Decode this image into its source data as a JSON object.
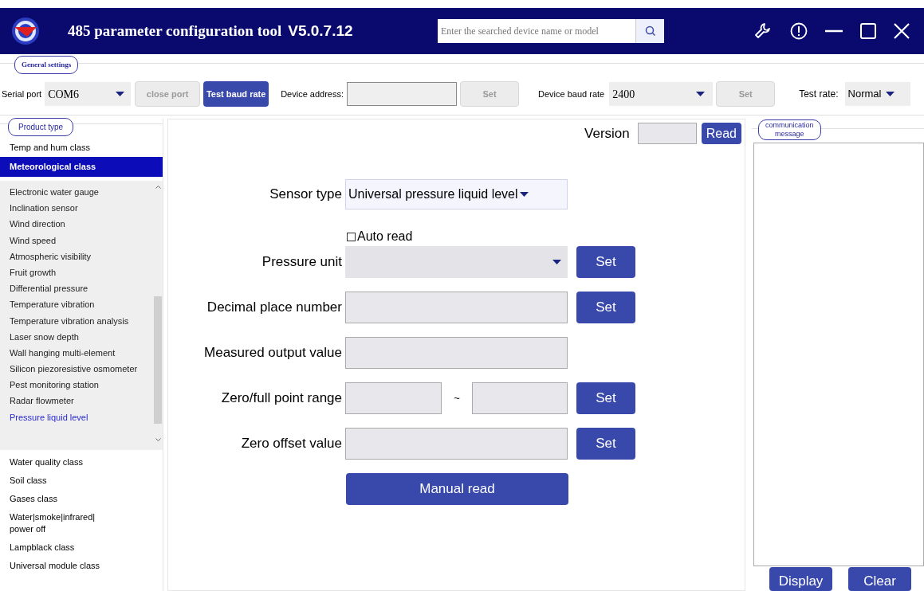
{
  "window": {
    "title": "485 parameter configuration tool",
    "version": "V5.0.7.12",
    "search": {
      "placeholder": "Enter the searched device name or model"
    }
  },
  "general_settings": {
    "legend": "General settings",
    "serial_port": {
      "label": "Serial port",
      "value": "COM6"
    },
    "close_port": {
      "label": "close port",
      "disabled": true
    },
    "test_baud_rate": {
      "label": "Test baud rate"
    },
    "device_address": {
      "label": "Device address:",
      "set": {
        "label": "Set",
        "disabled": true
      }
    },
    "device_baud_rate": {
      "label": "Device baud rate",
      "value": "2400",
      "set": {
        "label": "Set",
        "disabled": true
      }
    },
    "test_rate": {
      "label": "Test rate:",
      "value": "Normal"
    }
  },
  "product_type": {
    "legend": "Product type",
    "categories": [
      {
        "label": "Temp and hum class",
        "selected": false
      },
      {
        "label": "Meteorological class",
        "selected": true,
        "expanded": true,
        "children": [
          {
            "label": "Electronic water gauge",
            "selected": false
          },
          {
            "label": "Inclination sensor",
            "selected": false
          },
          {
            "label": "Wind direction",
            "selected": false
          },
          {
            "label": "Wind speed",
            "selected": false
          },
          {
            "label": "Atmospheric visibility",
            "selected": false
          },
          {
            "label": "Fruit growth",
            "selected": false
          },
          {
            "label": "Differential pressure",
            "selected": false
          },
          {
            "label": "Temperature vibration",
            "selected": false
          },
          {
            "label": "Temperature vibration analysis",
            "selected": false
          },
          {
            "label": "Laser snow depth",
            "selected": false
          },
          {
            "label": "Wall hanging multi-element",
            "selected": false
          },
          {
            "label": "Silicon piezoresistive osmometer",
            "selected": false
          },
          {
            "label": "Pest monitoring station",
            "selected": false
          },
          {
            "label": "Radar flowmeter",
            "selected": false
          },
          {
            "label": "Pressure liquid level",
            "selected": true
          }
        ]
      },
      {
        "label": "Water quality class",
        "selected": false
      },
      {
        "label": "Soil class",
        "selected": false
      },
      {
        "label": "Gases class",
        "selected": false
      },
      {
        "label": "Water|smoke|infrared|\npower off",
        "selected": false
      },
      {
        "label": "Lampblack class",
        "selected": false
      },
      {
        "label": "Universal module class",
        "selected": false
      }
    ]
  },
  "form": {
    "version": {
      "label": "Version",
      "button": "Read"
    },
    "sensor_type": {
      "label": "Sensor type",
      "value": "Universal pressure liquid level"
    },
    "auto_read": {
      "label": "Auto read",
      "checked": false
    },
    "rows": [
      {
        "kind": "select",
        "label": "Pressure unit",
        "button": "Set"
      },
      {
        "kind": "input",
        "label": "Decimal place number",
        "button": "Set"
      },
      {
        "kind": "input",
        "label": "Measured output value"
      },
      {
        "kind": "range",
        "label": "Zero/full point range",
        "separator": "~",
        "button": "Set"
      },
      {
        "kind": "input",
        "label": "Zero offset value",
        "button": "Set"
      }
    ],
    "manual_read": "Manual read"
  },
  "communication": {
    "legend": "communication\nmessage",
    "buttons": [
      "Display",
      "Clear"
    ]
  }
}
